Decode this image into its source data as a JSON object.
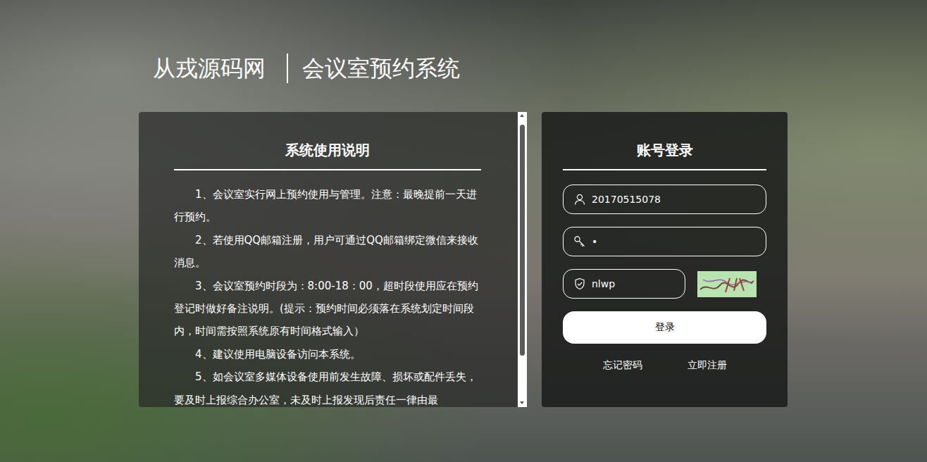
{
  "header": {
    "site": "从戎源码网",
    "system": "会议室预约系统"
  },
  "instructions": {
    "title": "系统使用说明",
    "paragraphs": [
      "1、会议室实行网上预约使用与管理。注意：最晚提前一天进行预约。",
      "2、若使用QQ邮箱注册，用户可通过QQ邮箱绑定微信来接收消息。",
      "3、会议室预约时段为：8:00-18：00，超时段使用应在预约登记时做好备注说明。(提示：预约时间必须落在系统划定时间段内，时间需按照系统原有时间格式输入）",
      "4、建议使用电脑设备访问本系统。",
      "5、如会议室多媒体设备使用前发生故障、损坏或配件丢失，要及时上报综合办公室，未及时上报发现后责任一律由最"
    ],
    "scrollbar": {
      "level": 0.84
    }
  },
  "login": {
    "title": "账号登录",
    "fields": [
      {
        "kind": "user",
        "value": "20170515078"
      },
      {
        "kind": "password",
        "value": "•"
      },
      {
        "kind": "captcha",
        "value": "nlwp"
      }
    ],
    "submit": "登录",
    "links": [
      "忘记密码",
      "立即注册"
    ]
  }
}
